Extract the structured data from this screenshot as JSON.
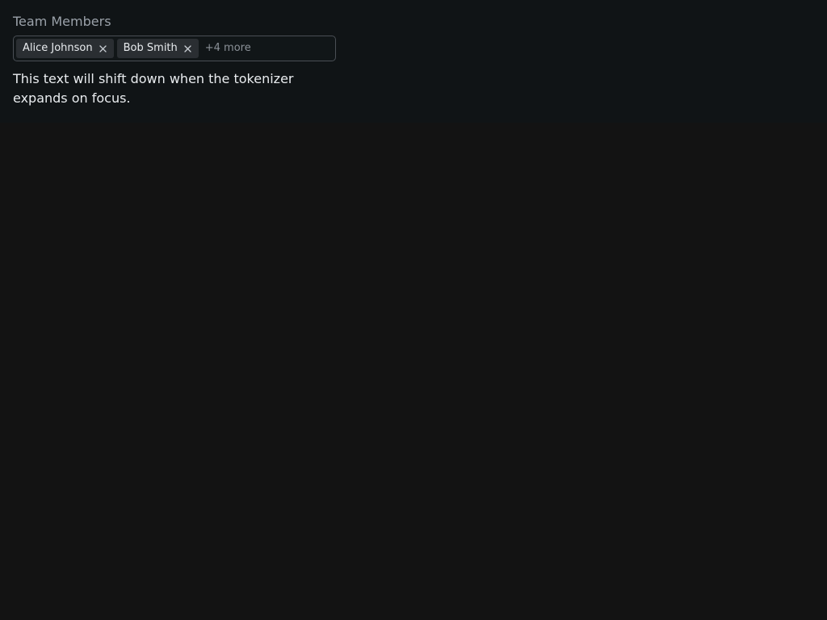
{
  "field": {
    "label": "Team Members",
    "tokens": [
      {
        "label": "Alice Johnson",
        "remove_icon": "close-icon"
      },
      {
        "label": "Bob Smith",
        "remove_icon": "close-icon"
      }
    ],
    "more_label": "+4 more"
  },
  "helper_text": "This text will shift down when the tokenizer expands on focus.",
  "colors": {
    "background": "#131313",
    "token_bg": "#2a2e32",
    "border": "#4a4f55",
    "muted_text": "#9aa1a9"
  }
}
